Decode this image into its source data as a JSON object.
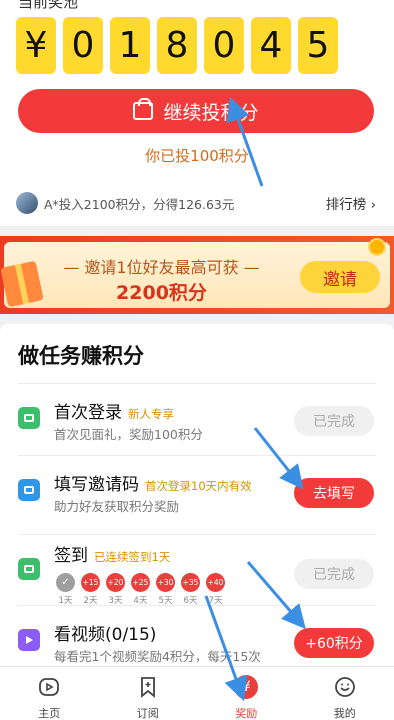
{
  "pool": {
    "label": "当前奖池",
    "digits": [
      "¥",
      "0",
      "1",
      "8",
      "0",
      "4",
      "5"
    ],
    "cta_label": "继续投积分",
    "invested_text": "你已投100积分",
    "winner_text": "A*投入2100积分，分得126.63元",
    "rank_link": "排行榜 ›"
  },
  "banner": {
    "line1": "— 邀请1位好友最高可获 —",
    "line2": "2200积分",
    "invite_label": "邀请"
  },
  "tasks": {
    "title": "做任务赚积分",
    "items": [
      {
        "name": "首次登录",
        "tag": "新人专享",
        "desc": "首次见面礼，奖励100积分",
        "button": "已完成",
        "icon_color": "#3cbf6a",
        "icon": "login-icon"
      },
      {
        "name": "填写邀请码",
        "tag": "首次登录10天内有效",
        "desc": "助力好友获取积分奖励",
        "button": "去填写",
        "icon_color": "#2f96e8",
        "icon": "invite-code-icon"
      },
      {
        "name": "签到",
        "tag": "已连续签到1天",
        "desc": "",
        "button": "已完成",
        "icon_color": "#3cbf6a",
        "icon": "calendar-icon"
      },
      {
        "name": "看视频(0/15)",
        "tag": "",
        "desc": "每看完1个视频奖励4积分，每天15次",
        "button": "+60积分",
        "icon_color": "#8b5cf6",
        "icon": "play-icon"
      }
    ],
    "checkin_days": [
      {
        "value": "✓",
        "label": "1天"
      },
      {
        "value": "+15",
        "label": "2天"
      },
      {
        "value": "+20",
        "label": "3天"
      },
      {
        "value": "+25",
        "label": "4天"
      },
      {
        "value": "+30",
        "label": "5天"
      },
      {
        "value": "+35",
        "label": "6天"
      },
      {
        "value": "+40",
        "label": "7天"
      }
    ]
  },
  "tabbar": {
    "items": [
      {
        "label": "主页",
        "icon": "home-icon"
      },
      {
        "label": "订阅",
        "icon": "bookmark-icon"
      },
      {
        "label": "奖励",
        "icon": "reward-icon",
        "glyph": "¥"
      },
      {
        "label": "我的",
        "icon": "smiley-icon"
      }
    ]
  },
  "colors": {
    "accent": "#f23a3a",
    "digit_bg": "#ffd92e",
    "arrow": "#3a8fe3"
  }
}
